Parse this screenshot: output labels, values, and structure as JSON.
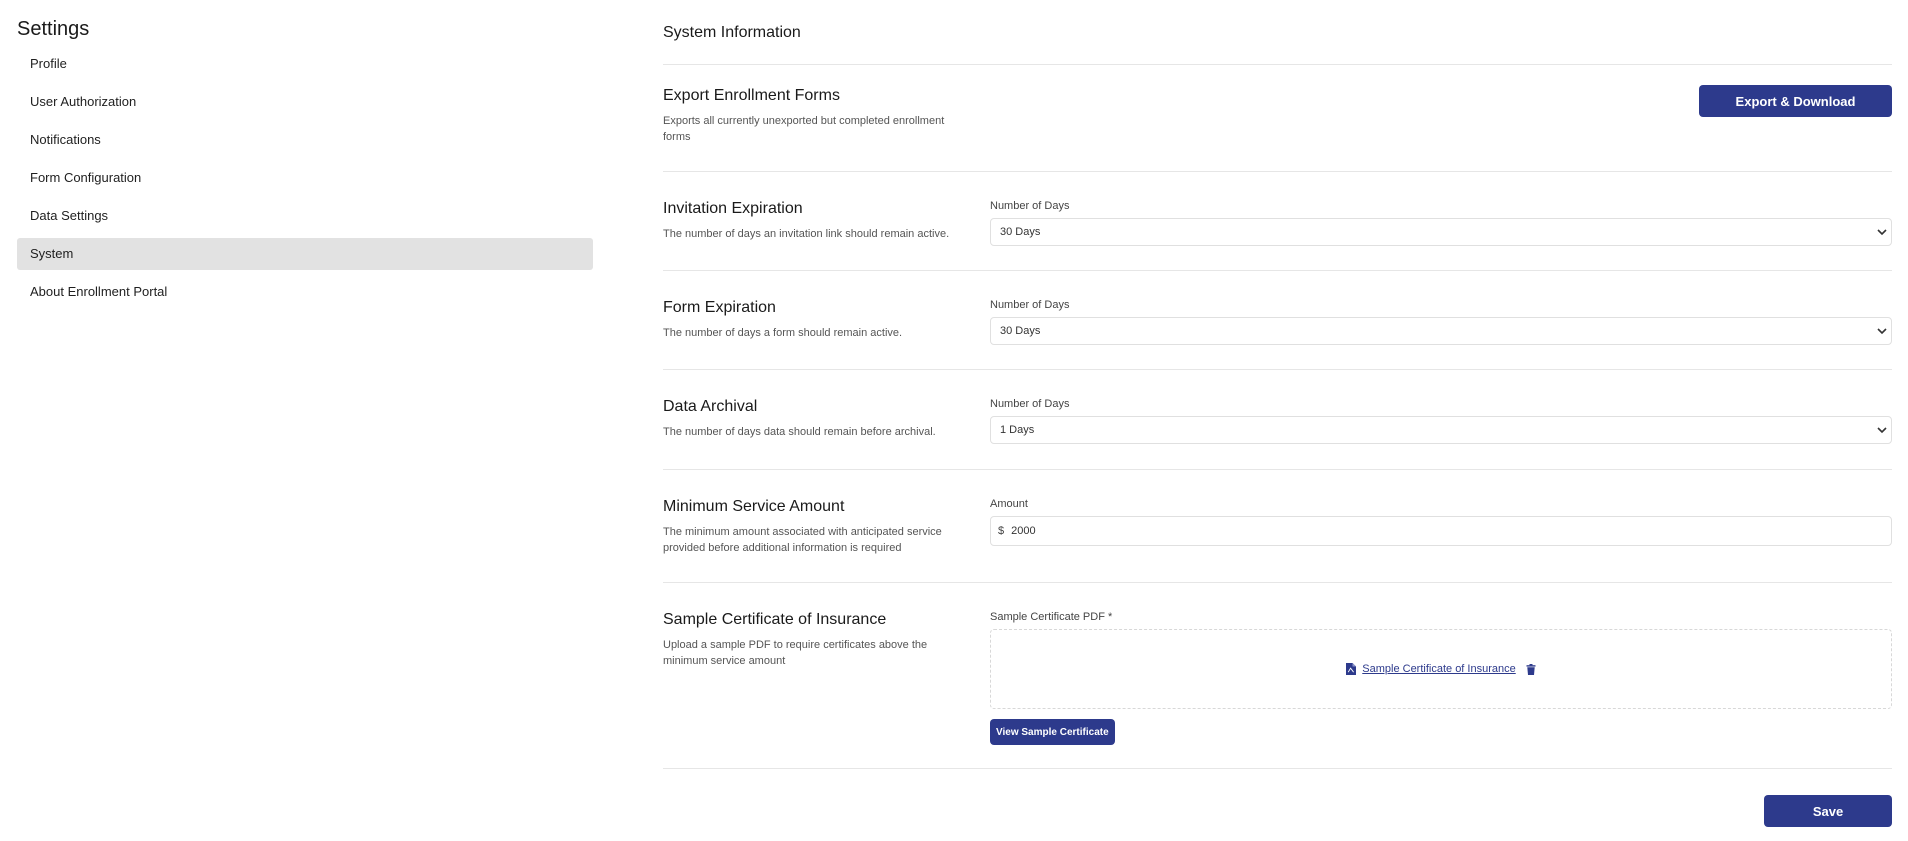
{
  "sidebar": {
    "title": "Settings",
    "items": [
      {
        "label": "Profile"
      },
      {
        "label": "User Authorization"
      },
      {
        "label": "Notifications"
      },
      {
        "label": "Form Configuration"
      },
      {
        "label": "Data Settings"
      },
      {
        "label": "System",
        "active": true
      },
      {
        "label": "About Enrollment Portal"
      }
    ]
  },
  "main": {
    "title": "System Information",
    "export": {
      "title": "Export Enrollment Forms",
      "desc": "Exports all currently unexported but completed enrollment forms",
      "button": "Export & Download"
    },
    "invitation": {
      "title": "Invitation Expiration",
      "desc": "The number of days an invitation link should remain active.",
      "label": "Number of Days",
      "value": "30 Days"
    },
    "form": {
      "title": "Form Expiration",
      "desc": "The number of days a form should remain active.",
      "label": "Number of Days",
      "value": "30 Days"
    },
    "archival": {
      "title": "Data Archival",
      "desc": "The number of days data should remain before archival.",
      "label": "Number of Days",
      "value": "1 Days"
    },
    "min_service": {
      "title": "Minimum Service Amount",
      "desc": "The minimum amount associated with anticipated service provided before additional information is required",
      "label": "Amount",
      "currency": "$",
      "value": "2000"
    },
    "certificate": {
      "title": "Sample Certificate of Insurance",
      "desc": "Upload a sample PDF to require certificates above the minimum service amount",
      "label": "Sample Certificate PDF *",
      "file_name": "Sample Certificate of Insurance",
      "view_button": "View Sample Certificate"
    },
    "save_button": "Save"
  },
  "icons": {
    "select": "chevron-down-icon",
    "file": "pdf-file-icon",
    "delete": "trash-icon"
  },
  "colors": {
    "primary": "#2d3a8c",
    "active_nav_bg": "#e2e2e2",
    "divider": "#e6e6e6"
  }
}
